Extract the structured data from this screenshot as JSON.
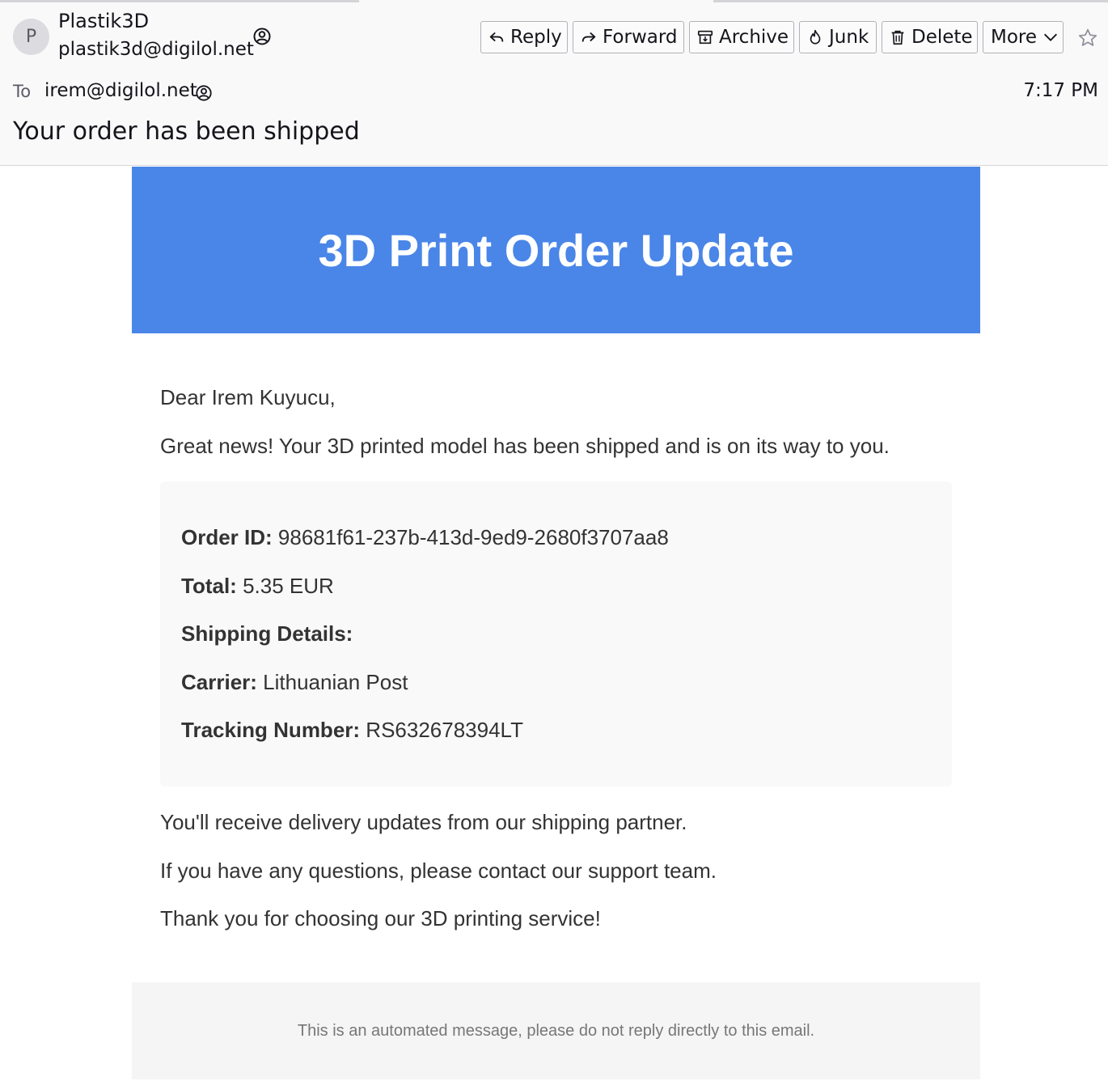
{
  "header": {
    "avatar_letter": "P",
    "sender_name": "Plastik3D",
    "sender_email": "plastik3d@digilol.net",
    "to_label": "To",
    "to_address": "irem@digilol.net",
    "time": "7:17 PM",
    "subject": "Your order has been shipped"
  },
  "toolbar": {
    "reply": "Reply",
    "forward": "Forward",
    "archive": "Archive",
    "junk": "Junk",
    "delete": "Delete",
    "more": "More"
  },
  "email": {
    "banner_title": "3D Print Order Update",
    "greeting": "Dear Irem Kuyucu,",
    "intro": "Great news! Your 3D printed model has been shipped and is on its way to you.",
    "details": {
      "order_id_label": "Order ID:",
      "order_id": "98681f61-237b-413d-9ed9-2680f3707aa8",
      "total_label": "Total:",
      "total": "5.35 EUR",
      "shipping_label": "Shipping Details:",
      "carrier_label": "Carrier:",
      "carrier": "Lithuanian Post",
      "tracking_label": "Tracking Number:",
      "tracking": "RS632678394LT"
    },
    "updates": "You'll receive delivery updates from our shipping partner.",
    "questions": "If you have any questions, please contact our support team.",
    "thanks": "Thank you for choosing our 3D printing service!",
    "footer": "This is an automated message, please do not reply directly to this email."
  },
  "colors": {
    "banner": "#4a86e8",
    "text": "#333333",
    "footer_text": "#777777"
  }
}
